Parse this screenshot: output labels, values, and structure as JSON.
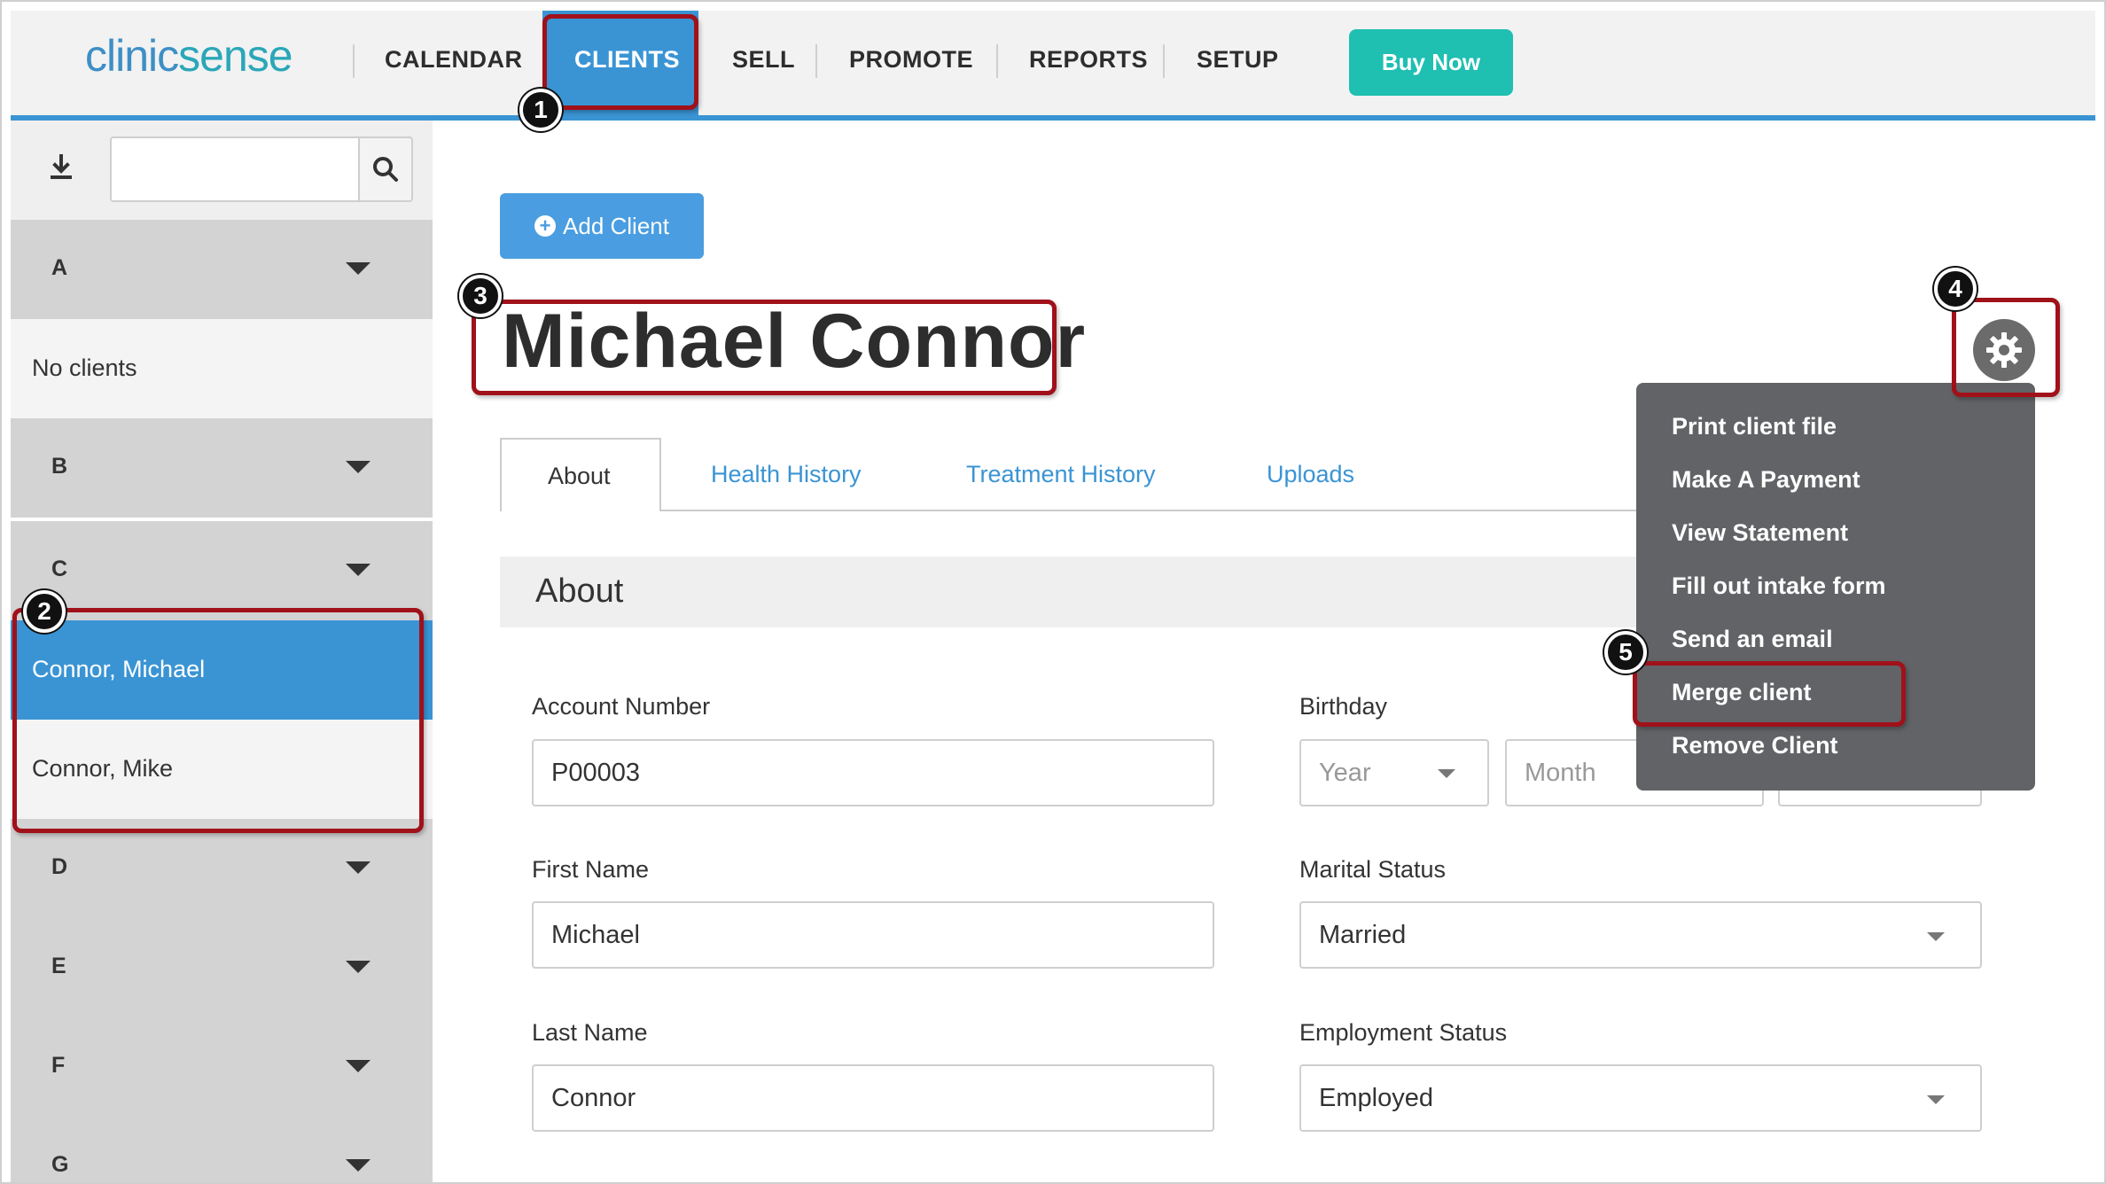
{
  "brand": {
    "logo_main": "clinic",
    "logo_accent": "sense"
  },
  "nav": {
    "items": [
      "CALENDAR",
      "CLIENTS",
      "SELL",
      "PROMOTE",
      "REPORTS",
      "SETUP"
    ],
    "active": "CLIENTS",
    "buy_now": "Buy Now"
  },
  "sidebar": {
    "search_placeholder": "",
    "groups": [
      {
        "letter": "A"
      },
      {
        "letter": "B"
      },
      {
        "letter": "C"
      },
      {
        "letter": "D"
      },
      {
        "letter": "E"
      },
      {
        "letter": "F"
      },
      {
        "letter": "G"
      }
    ],
    "no_clients": "No clients",
    "clients_c": [
      "Connor, Michael",
      "Connor, Mike"
    ]
  },
  "main": {
    "add_client": "Add Client",
    "client_name": "Michael Connor",
    "tabs": [
      "About",
      "Health History",
      "Treatment History",
      "Uploads"
    ],
    "active_tab": "About",
    "section_title": "About",
    "fields": {
      "account_number": {
        "label": "Account Number",
        "value": "P00003"
      },
      "first_name": {
        "label": "First Name",
        "value": "Michael"
      },
      "last_name": {
        "label": "Last Name",
        "value": "Connor"
      },
      "birthday": {
        "label": "Birthday",
        "year_placeholder": "Year",
        "month_placeholder": "Month"
      },
      "marital_status": {
        "label": "Marital Status",
        "value": "Married"
      },
      "employment_status": {
        "label": "Employment Status",
        "value": "Employed"
      }
    }
  },
  "menu": {
    "items": [
      "Print client file",
      "Make A Payment",
      "View Statement",
      "Fill out intake form",
      "Send an email",
      "Merge client",
      "Remove Client"
    ]
  },
  "annotations": {
    "badges": [
      "1",
      "2",
      "3",
      "4",
      "5"
    ],
    "highlight_color": "#a0111a"
  },
  "colors": {
    "primary": "#3a94d4",
    "buy_now": "#1fbfb2",
    "menu_bg": "#616366"
  }
}
